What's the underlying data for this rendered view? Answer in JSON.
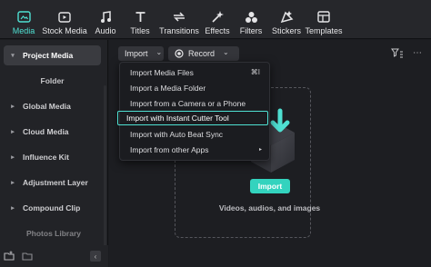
{
  "toolbar": {
    "items": [
      {
        "label": "Media",
        "icon": "media-icon",
        "active": true
      },
      {
        "label": "Stock Media",
        "icon": "stock-media-icon"
      },
      {
        "label": "Audio",
        "icon": "music-note-icon"
      },
      {
        "label": "Titles",
        "icon": "titles-icon"
      },
      {
        "label": "Transitions",
        "icon": "transitions-icon"
      },
      {
        "label": "Effects",
        "icon": "effects-icon"
      },
      {
        "label": "Filters",
        "icon": "filters-icon"
      },
      {
        "label": "Stickers",
        "icon": "stickers-icon"
      },
      {
        "label": "Templates",
        "icon": "templates-icon"
      }
    ]
  },
  "sidebar": {
    "items": [
      {
        "label": "Project Media",
        "expanded": true,
        "selected": true
      },
      {
        "label": "Folder"
      },
      {
        "label": "Global Media"
      },
      {
        "label": "Cloud Media"
      },
      {
        "label": "Influence Kit"
      },
      {
        "label": "Adjustment Layer"
      },
      {
        "label": "Compound Clip"
      },
      {
        "label": "Photos Library"
      }
    ],
    "collapse_glyph": "‹"
  },
  "main": {
    "import_label": "Import",
    "import_chevron": "⌄",
    "record_label": "Record",
    "record_chevron": "⌄",
    "more_glyph": "⋯"
  },
  "menu": {
    "items": [
      {
        "label": "Import Media Files",
        "shortcut": "⌘I"
      },
      {
        "label": "Import a Media Folder"
      },
      {
        "label": "Import from a Camera or a Phone"
      },
      {
        "label": "Import with Instant Cutter Tool",
        "highlighted": true
      },
      {
        "label": "Import with Auto Beat Sync"
      },
      {
        "label": "Import from other Apps",
        "submenu_arrow": "▸"
      }
    ]
  },
  "dropzone": {
    "button_label": "Import",
    "caption": "Videos, audios, and images"
  },
  "colors": {
    "accent": "#4fe0d2",
    "import_button": "#33d3be",
    "background": "#1b1c20"
  }
}
